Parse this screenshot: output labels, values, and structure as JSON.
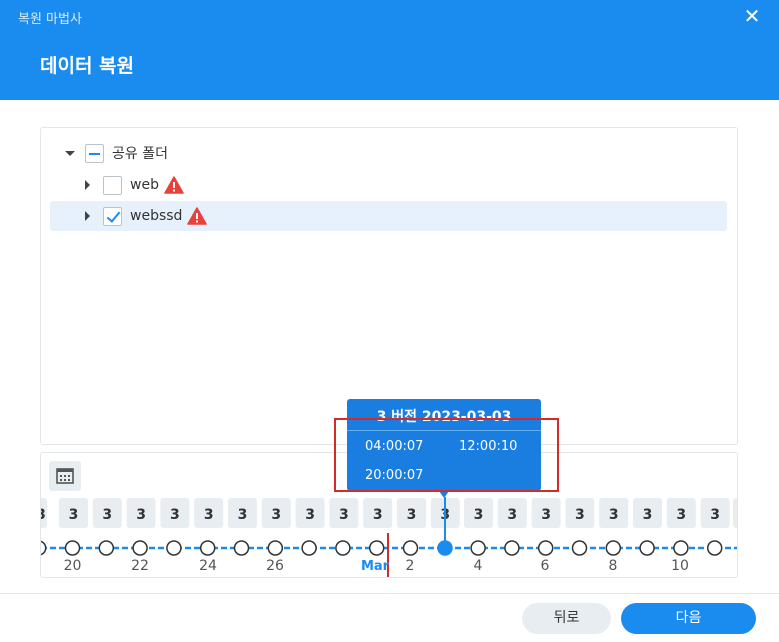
{
  "header": {
    "wizard_title": "복원 마법사",
    "step_title": "데이터 복원",
    "close_icon": "close-icon"
  },
  "tree": {
    "root": {
      "label": "공유 폴더",
      "state": "partial",
      "expanded": true
    },
    "items": [
      {
        "label": "web",
        "checked": false,
        "warning": true
      },
      {
        "label": "webssd",
        "checked": true,
        "warning": true,
        "selected": true
      }
    ]
  },
  "timeline": {
    "calendar_icon": "calendar-icon",
    "badges_left": [
      "3",
      "3",
      "3",
      "3",
      "3",
      "3",
      "3",
      "3",
      "3",
      "3",
      "3",
      "3"
    ],
    "badges_right": [
      "3",
      "3",
      "3",
      "3",
      "3",
      "3",
      "3",
      "3"
    ],
    "date_labels": [
      "20",
      "22",
      "24",
      "26",
      "Mar",
      "2",
      "4",
      "6",
      "8",
      "10"
    ],
    "accent_color": "#1a8cf0",
    "today_marker_color": "#d42a2a"
  },
  "tooltip": {
    "title": "3 버전 2023-03-03",
    "times": [
      "04:00:07",
      "12:00:10",
      "20:00:07"
    ]
  },
  "footer": {
    "back_label": "뒤로",
    "next_label": "다음"
  }
}
